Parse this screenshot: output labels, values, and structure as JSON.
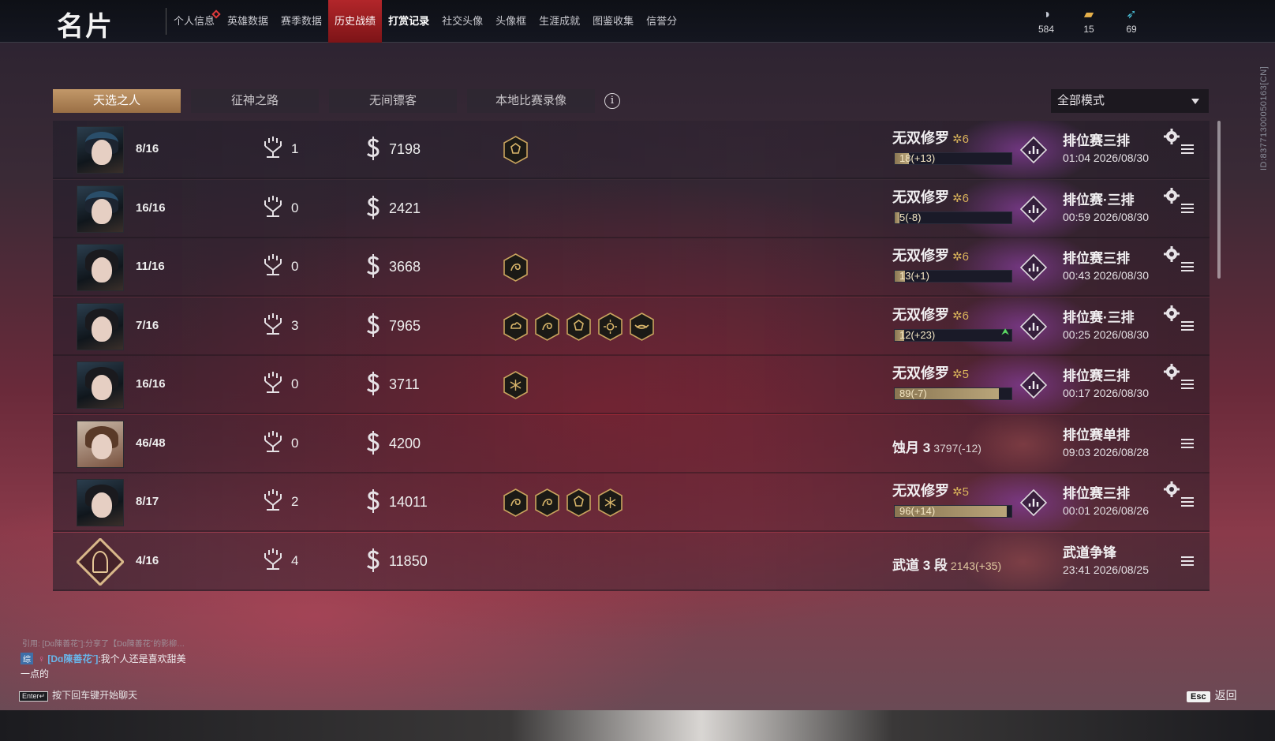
{
  "header": {
    "title": "名片",
    "tabs": [
      {
        "label": "个人信息",
        "active": false,
        "bold": false,
        "dot": true
      },
      {
        "label": "英雄数据",
        "active": false,
        "bold": false
      },
      {
        "label": "赛季数据",
        "active": false,
        "bold": false
      },
      {
        "label": "历史战绩",
        "active": true,
        "bold": false
      },
      {
        "label": "打赏记录",
        "active": false,
        "bold": true
      },
      {
        "label": "社交头像",
        "active": false,
        "bold": false
      },
      {
        "label": "头像框",
        "active": false,
        "bold": false
      },
      {
        "label": "生涯成就",
        "active": false,
        "bold": false
      },
      {
        "label": "图鉴收集",
        "active": false,
        "bold": false
      },
      {
        "label": "信誉分",
        "active": false,
        "bold": false
      }
    ],
    "currencies": [
      {
        "icon": "mask-icon",
        "value": "584"
      },
      {
        "icon": "ticket-icon",
        "value": "15"
      },
      {
        "icon": "feather-icon",
        "value": "69"
      }
    ]
  },
  "player_id": "ID:8377130005016​3[CN]",
  "subtabs": [
    "天选之人",
    "征神之路",
    "无间镖客",
    "本地比赛录像"
  ],
  "active_subtab": 0,
  "mode_select": "全部模式",
  "matches": [
    {
      "avatar": "a-hat",
      "rank": "8/16",
      "kills": "1",
      "score": "7198",
      "badges": [
        "shield-badge"
      ],
      "tier": "无双修罗",
      "stars": "6",
      "progress": "18(+13)",
      "fill": 0.12,
      "up": false,
      "type": "排位赛三排",
      "time": "01:04 2026/08/30",
      "gear": true
    },
    {
      "avatar": "a-hat",
      "rank": "16/16",
      "kills": "0",
      "score": "2421",
      "badges": [],
      "tier": "无双修罗",
      "stars": "6",
      "progress": "5(-8)",
      "fill": 0.04,
      "up": false,
      "type": "排位赛·三排",
      "time": "00:59 2026/08/30",
      "gear": true
    },
    {
      "avatar": "a-plain",
      "rank": "11/16",
      "kills": "0",
      "score": "3668",
      "badges": [
        "dragon-badge"
      ],
      "tier": "无双修罗",
      "stars": "6",
      "progress": "13(+1)",
      "fill": 0.09,
      "up": false,
      "type": "排位赛三排",
      "time": "00:43 2026/08/30",
      "gear": true
    },
    {
      "avatar": "a-plain",
      "rank": "7/16",
      "kills": "3",
      "score": "7965",
      "badges": [
        "cloud-badge",
        "dragon-badge",
        "shield-badge",
        "sun-badge",
        "wing-badge"
      ],
      "tier": "无双修罗",
      "stars": "6",
      "progress": "12(+23)",
      "fill": 0.08,
      "up": true,
      "type": "排位赛·三排",
      "time": "00:25 2026/08/30",
      "gear": true
    },
    {
      "avatar": "a-plain",
      "rank": "16/16",
      "kills": "0",
      "score": "3711",
      "badges": [
        "star-badge"
      ],
      "tier": "无双修罗",
      "stars": "5",
      "progress": "89(-7)",
      "fill": 0.89,
      "up": false,
      "type": "排位赛三排",
      "time": "00:17 2026/08/30",
      "gear": true
    },
    {
      "avatar": "a-cap",
      "rank": "46/48",
      "kills": "0",
      "score": "4200",
      "badges": [],
      "plain": true,
      "plain_rank": "蚀月 3",
      "plain_sub": "3797(-12)",
      "type": "排位赛单排",
      "time": "09:03 2026/08/28",
      "gear": false
    },
    {
      "avatar": "a-plain",
      "rank": "8/17",
      "kills": "2",
      "score": "14011",
      "badges": [
        "dragon-badge",
        "dragon-badge",
        "shield-badge",
        "star-badge"
      ],
      "tier": "无双修罗",
      "stars": "5",
      "progress": "96(+14)",
      "fill": 0.96,
      "up": false,
      "type": "排位赛三排",
      "time": "00:01 2026/08/26",
      "gear": true
    },
    {
      "avatar": "a-emblem",
      "rank": "4/16",
      "kills": "4",
      "score": "11850",
      "badges": [],
      "plain": true,
      "plain_rank": "武道 3 段",
      "plain_sub": "2143(+35)",
      "type": "武道争锋",
      "time": "23:41 2026/08/25",
      "gear": false
    }
  ],
  "chat": {
    "quote": "引用: [Dɑ陳善花˘]:分享了【Dɑ陳善花˘的影柳…",
    "tag": "综",
    "name": "[Dɑ陳善花˘]",
    "message": ":我个人还是喜欢甜美",
    "message2": "一点的",
    "enter_key": "Enter↵",
    "hint": "按下回车键开始聊天"
  },
  "back": {
    "key": "Esc",
    "label": "返回"
  }
}
